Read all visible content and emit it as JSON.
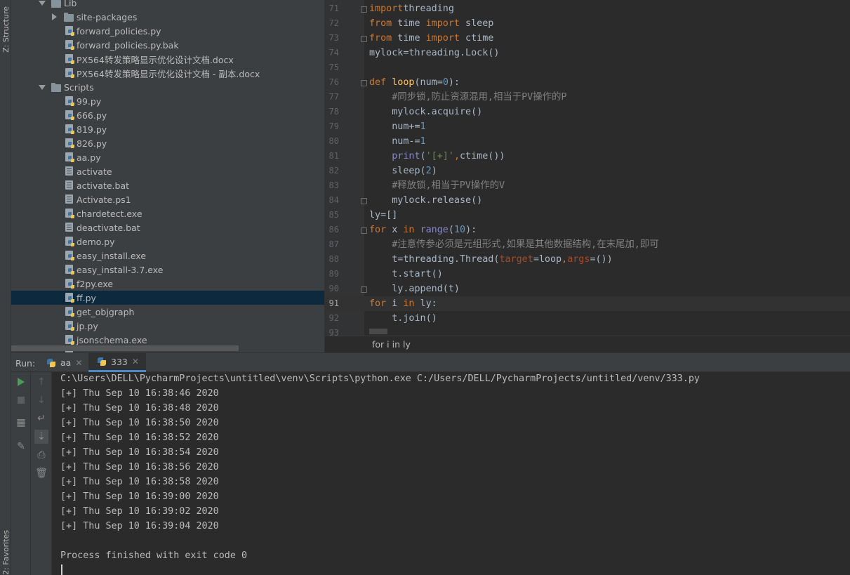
{
  "side_stripe": {
    "structure_label": "Z: Structure",
    "favorites_label": "2: Favorites"
  },
  "project_tree": [
    {
      "label": "Lib",
      "kind": "folder",
      "expanded": true,
      "depth": 0
    },
    {
      "label": "site-packages",
      "kind": "folder",
      "expanded": false,
      "depth": 1
    },
    {
      "label": "forward_policies.py",
      "kind": "py",
      "depth": 1
    },
    {
      "label": "forward_policies.py.bak",
      "kind": "py",
      "depth": 1
    },
    {
      "label": "PX564转发策略显示优化设计文档.docx",
      "kind": "py",
      "depth": 1
    },
    {
      "label": "PX564转发策略显示优化设计文档 - 副本.docx",
      "kind": "py",
      "depth": 1
    },
    {
      "label": "Scripts",
      "kind": "folder",
      "expanded": true,
      "depth": 0
    },
    {
      "label": "99.py",
      "kind": "py",
      "depth": 1
    },
    {
      "label": "666.py",
      "kind": "py",
      "depth": 1
    },
    {
      "label": "819.py",
      "kind": "py",
      "depth": 1
    },
    {
      "label": "826.py",
      "kind": "py",
      "depth": 1
    },
    {
      "label": "aa.py",
      "kind": "py",
      "depth": 1
    },
    {
      "label": "activate",
      "kind": "file",
      "depth": 1
    },
    {
      "label": "activate.bat",
      "kind": "file",
      "depth": 1
    },
    {
      "label": "Activate.ps1",
      "kind": "file",
      "depth": 1
    },
    {
      "label": "chardetect.exe",
      "kind": "py",
      "depth": 1
    },
    {
      "label": "deactivate.bat",
      "kind": "file",
      "depth": 1
    },
    {
      "label": "demo.py",
      "kind": "py",
      "depth": 1
    },
    {
      "label": "easy_install.exe",
      "kind": "py",
      "depth": 1
    },
    {
      "label": "easy_install-3.7.exe",
      "kind": "py",
      "depth": 1
    },
    {
      "label": "f2py.exe",
      "kind": "py",
      "depth": 1
    },
    {
      "label": "ff.py",
      "kind": "py",
      "depth": 1,
      "selected": true
    },
    {
      "label": "get_objgraph",
      "kind": "py",
      "depth": 1
    },
    {
      "label": "jp.py",
      "kind": "py",
      "depth": 1
    },
    {
      "label": "jsonschema.exe",
      "kind": "py",
      "depth": 1
    },
    {
      "label": "",
      "kind": "py",
      "depth": 1
    }
  ],
  "editor": {
    "lines": [
      {
        "num": "71",
        "fold": true,
        "tokens": [
          [
            "k",
            "import"
          ],
          [
            "",
            "threading"
          ]
        ]
      },
      {
        "num": "72",
        "tokens": [
          [
            "k",
            "from"
          ],
          [
            "",
            " time "
          ],
          [
            "k",
            "import"
          ],
          [
            "",
            " sleep"
          ]
        ]
      },
      {
        "num": "73",
        "fold": true,
        "tokens": [
          [
            "k",
            "from"
          ],
          [
            "",
            " time "
          ],
          [
            "k",
            "import"
          ],
          [
            "",
            " ctime"
          ]
        ]
      },
      {
        "num": "74",
        "tokens": [
          [
            "",
            "mylock=threading.Lock()"
          ]
        ]
      },
      {
        "num": "75",
        "tokens": []
      },
      {
        "num": "76",
        "fold": true,
        "tokens": [
          [
            "k",
            "def "
          ],
          [
            "f",
            "loop"
          ],
          [
            "",
            "(num="
          ],
          [
            "n",
            "0"
          ],
          [
            "",
            "):"
          ]
        ]
      },
      {
        "num": "77",
        "tokens": [
          [
            "c",
            "    #同步锁,防止资源混用,相当于PV操作的P"
          ]
        ]
      },
      {
        "num": "78",
        "tokens": [
          [
            "",
            "    mylock.acquire()"
          ]
        ]
      },
      {
        "num": "79",
        "tokens": [
          [
            "",
            "    num+="
          ],
          [
            "n",
            "1"
          ]
        ]
      },
      {
        "num": "80",
        "tokens": [
          [
            "",
            "    num-="
          ],
          [
            "n",
            "1"
          ]
        ]
      },
      {
        "num": "81",
        "tokens": [
          [
            "b",
            "    print"
          ],
          [
            "",
            "("
          ],
          [
            "s",
            "'[+]'"
          ],
          [
            "k",
            ","
          ],
          [
            "",
            "ctime())"
          ]
        ]
      },
      {
        "num": "82",
        "tokens": [
          [
            "",
            "    sleep("
          ],
          [
            "n",
            "2"
          ],
          [
            "",
            ")"
          ]
        ]
      },
      {
        "num": "83",
        "tokens": [
          [
            "c",
            "    #释放锁,相当于PV操作的V"
          ]
        ]
      },
      {
        "num": "84",
        "fold": true,
        "tokens": [
          [
            "",
            "    mylock.release()"
          ]
        ]
      },
      {
        "num": "85",
        "tokens": [
          [
            "",
            "ly=[]"
          ]
        ]
      },
      {
        "num": "86",
        "fold": true,
        "tokens": [
          [
            "k",
            "for"
          ],
          [
            "",
            " x "
          ],
          [
            "k",
            "in "
          ],
          [
            "b",
            "range"
          ],
          [
            "",
            "("
          ],
          [
            "n",
            "10"
          ],
          [
            "",
            "):"
          ]
        ]
      },
      {
        "num": "87",
        "tokens": [
          [
            "c",
            "    #注意传参必须是元组形式,如果是其他数据结构,在末尾加,即可"
          ]
        ]
      },
      {
        "num": "88",
        "tokens": [
          [
            "",
            "    t=threading.Thread("
          ],
          [
            "p",
            "target"
          ],
          [
            "",
            "=loop"
          ],
          [
            "k",
            ","
          ],
          [
            "p",
            "args"
          ],
          [
            "",
            "=())"
          ]
        ]
      },
      {
        "num": "89",
        "tokens": [
          [
            "",
            "    t.start()"
          ]
        ]
      },
      {
        "num": "90",
        "fold": true,
        "tokens": [
          [
            "",
            "    ly.append(t)"
          ]
        ]
      },
      {
        "num": "91",
        "current": true,
        "tokens": [
          [
            "k",
            "for"
          ],
          [
            "",
            " i "
          ],
          [
            "k",
            "in"
          ],
          [
            "",
            " ly:"
          ]
        ]
      },
      {
        "num": "92",
        "tokens": [
          [
            "",
            "    t.join()"
          ]
        ]
      },
      {
        "num": "93",
        "tokens": []
      }
    ],
    "breadcrumb": "for i in ly"
  },
  "run": {
    "title": "Run:",
    "tabs": [
      {
        "label": "aa",
        "active": false
      },
      {
        "label": "333",
        "active": true
      }
    ],
    "console": [
      "C:\\Users\\DELL\\PycharmProjects\\untitled\\venv\\Scripts\\python.exe C:/Users/DELL/PycharmProjects/untitled/venv/333.py",
      "[+] Thu Sep 10 16:38:46 2020",
      "[+] Thu Sep 10 16:38:48 2020",
      "[+] Thu Sep 10 16:38:50 2020",
      "[+] Thu Sep 10 16:38:52 2020",
      "[+] Thu Sep 10 16:38:54 2020",
      "[+] Thu Sep 10 16:38:56 2020",
      "[+] Thu Sep 10 16:38:58 2020",
      "[+] Thu Sep 10 16:39:00 2020",
      "[+] Thu Sep 10 16:39:02 2020",
      "[+] Thu Sep 10 16:39:04 2020",
      "",
      "Process finished with exit code 0"
    ]
  },
  "colors": {
    "keyword": "#cc7832",
    "function": "#ffc66d",
    "number": "#6897bb",
    "comment": "#808080",
    "string": "#6a8759",
    "builtin": "#8888c6",
    "param": "#aa4926",
    "selection": "#0d293e",
    "run_play": "#499c54"
  },
  "toolbar_icons": {
    "left": [
      "run-icon",
      "stop-icon",
      "layout-icon",
      "pin-icon"
    ],
    "right": [
      "up-arrow-icon",
      "down-arrow-icon",
      "soft-wrap-icon",
      "scroll-to-end-icon",
      "print-icon",
      "trash-icon"
    ]
  }
}
